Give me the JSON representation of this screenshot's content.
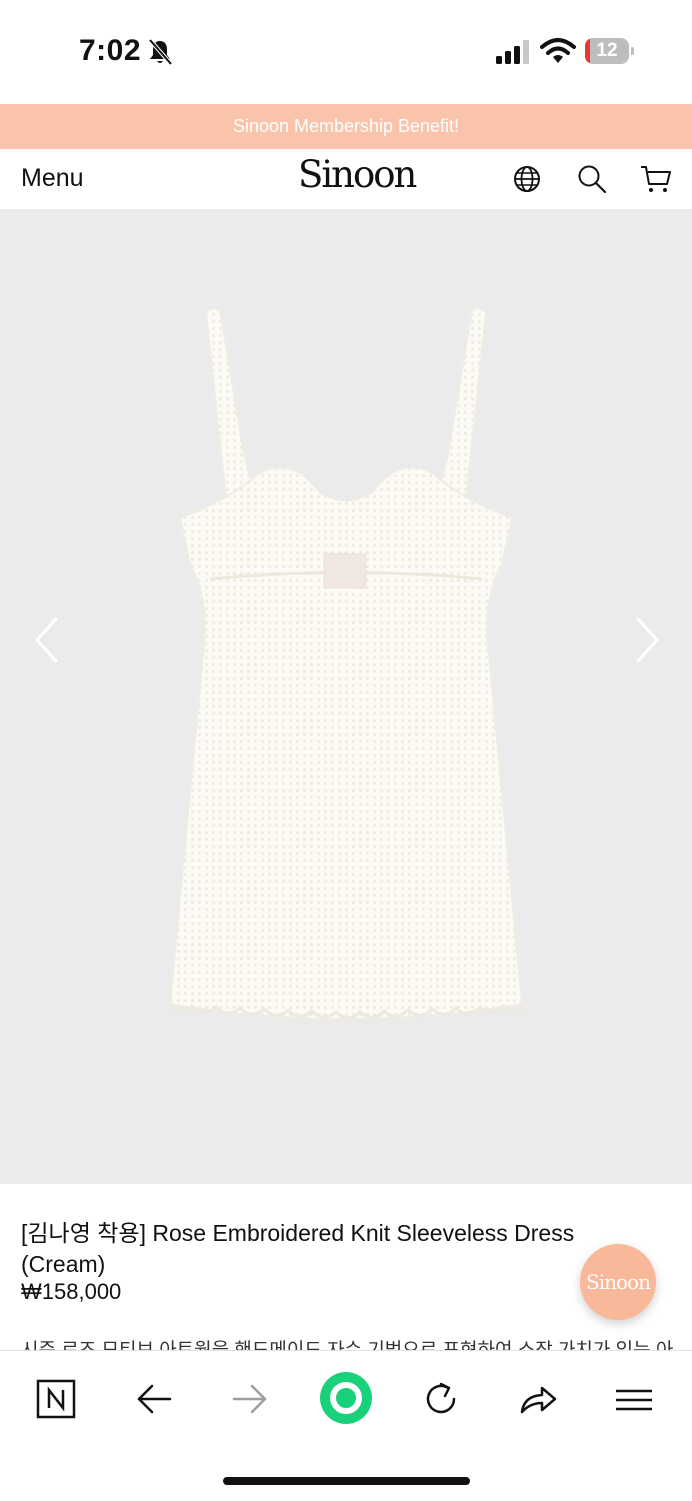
{
  "status_bar": {
    "time": "7:02",
    "battery_level": "12",
    "battery_fraction": 0.12,
    "icons": [
      "bell-slash-icon",
      "cellular-signal-icon",
      "wifi-icon",
      "battery-icon"
    ]
  },
  "banner": {
    "text": "Sinoon Membership Benefit!",
    "color": "#f9c4a9"
  },
  "header": {
    "menu_label": "Menu",
    "logo_text": "Sinoon",
    "icons": [
      "globe-icon",
      "search-icon",
      "cart-icon"
    ]
  },
  "gallery": {
    "background": "#ebebeb",
    "image": "cream-crochet-knit-sleeveless-dress",
    "prev_icon": "chevron-left-icon",
    "next_icon": "chevron-right-icon"
  },
  "product": {
    "title": "[김나영 착용] Rose Embroidered Knit Sleeveless Dress (Cream)",
    "price": "₩158,000",
    "description": "시즌 로즈 모티브 아트웍을 핸드메이드 자수 기법으로 표현하여 소장 가치가 있는 아"
  },
  "floating_button": {
    "label": "Sinoon",
    "color": "#f9b899"
  },
  "browser_toolbar": {
    "icons": [
      "naver-n-icon",
      "back-arrow-icon",
      "forward-arrow-icon",
      "green-dot-icon",
      "reload-icon",
      "share-icon",
      "hamburger-menu-icon"
    ]
  }
}
